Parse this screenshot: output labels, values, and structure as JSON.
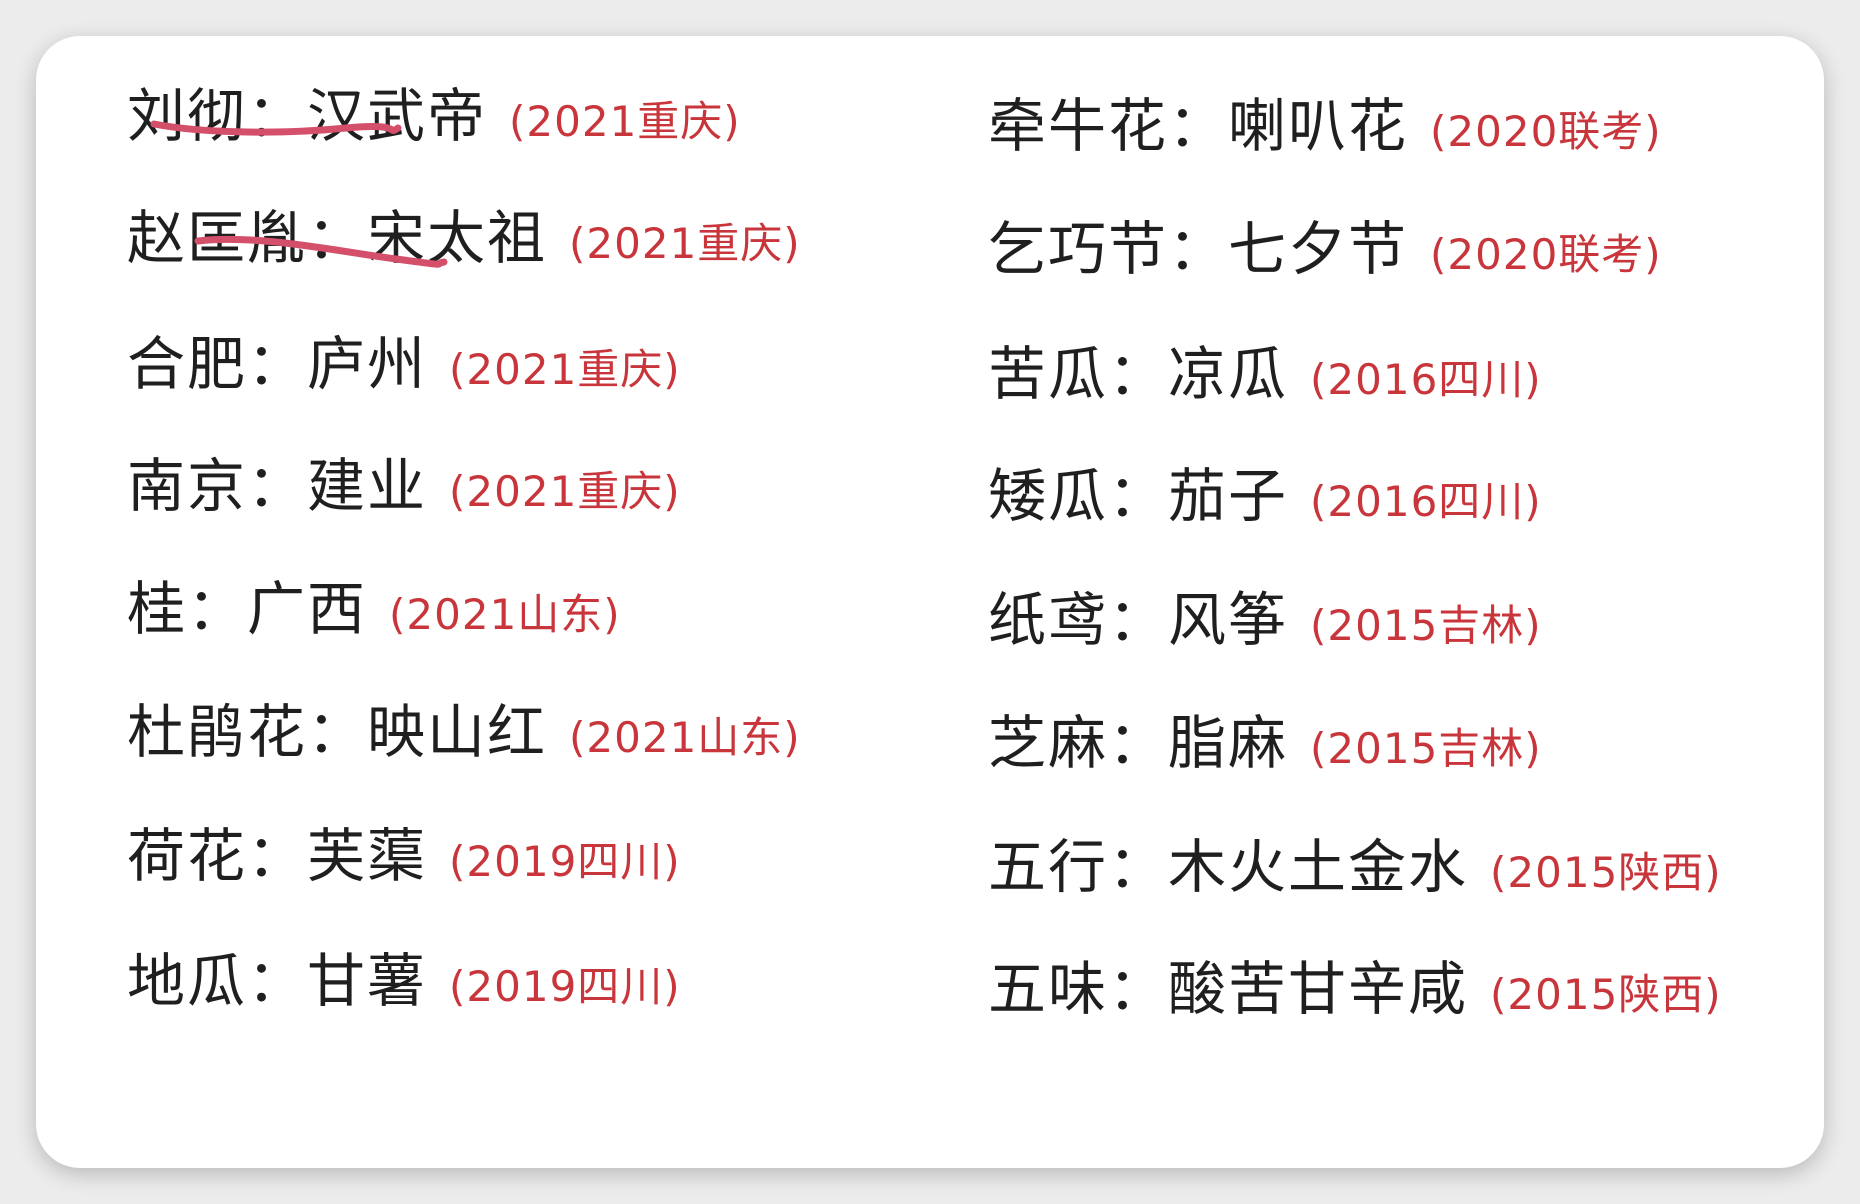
{
  "left_column": [
    {
      "term": "刘彻：汉武帝",
      "source": "(2021重庆)"
    },
    {
      "term": "赵匡胤：宋太祖",
      "source": "(2021重庆)"
    },
    {
      "term": "合肥：庐州",
      "source": "(2021重庆)"
    },
    {
      "term": "南京：建业",
      "source": "(2021重庆)"
    },
    {
      "term": "桂：广西",
      "source": "(2021山东)"
    },
    {
      "term": "杜鹃花：映山红",
      "source": "(2021山东)"
    },
    {
      "term": "荷花：芙蕖",
      "source": "(2019四川)"
    },
    {
      "term": "地瓜：甘薯",
      "source": "(2019四川)"
    }
  ],
  "right_column": [
    {
      "term": "牵牛花：喇叭花",
      "source": "(2020联考)"
    },
    {
      "term": "乞巧节：七夕节",
      "source": "(2020联考)"
    },
    {
      "term": "苦瓜：凉瓜",
      "source": "(2016四川)"
    },
    {
      "term": "矮瓜：茄子",
      "source": "(2016四川)"
    },
    {
      "term": "纸鸢：风筝",
      "source": "(2015吉林)"
    },
    {
      "term": "芝麻：脂麻",
      "source": "(2015吉林)"
    },
    {
      "term": "五行：木火土金水",
      "source": "(2015陕西)"
    },
    {
      "term": "五味：酸苦甘辛咸",
      "source": "(2015陕西)"
    }
  ],
  "colors": {
    "term_text": "#1f1f1f",
    "source_text": "#c8363c",
    "underline": "#d4506a",
    "card": "#ffffff"
  }
}
